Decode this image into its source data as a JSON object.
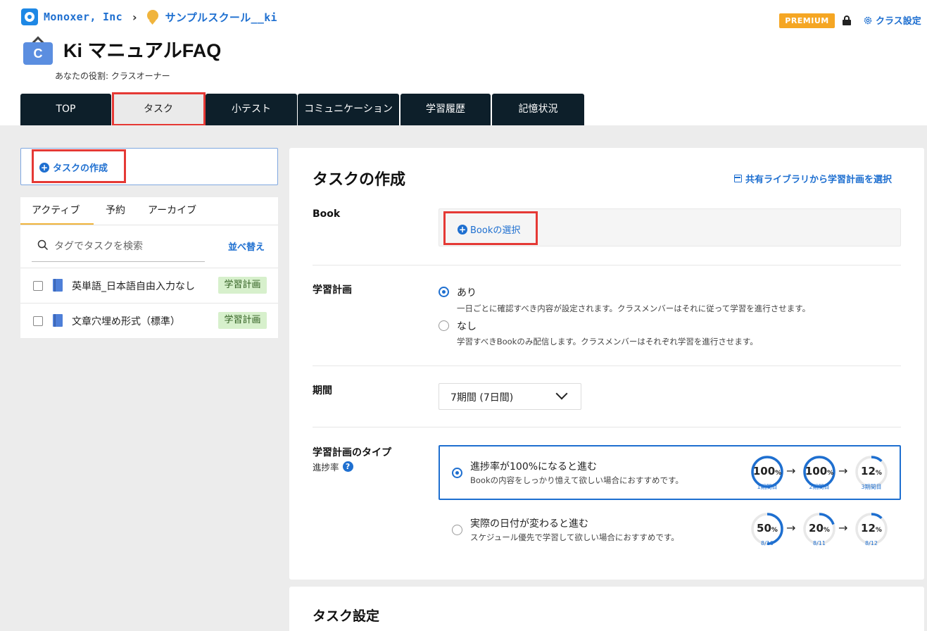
{
  "breadcrumb": {
    "org": "Monoxer, Inc",
    "school": "サンプルスクール__ki"
  },
  "header": {
    "class_title": "Ki マニュアルFAQ",
    "class_icon_letter": "C",
    "role": "あなたの役割: クラスオーナー",
    "premium_badge": "PREMIUM",
    "class_settings": "クラス設定"
  },
  "tabs": [
    "TOP",
    "タスク",
    "小テスト",
    "コミュニケーション",
    "学習履歴",
    "記憶状況"
  ],
  "sidebar": {
    "create_task": "タスクの作成",
    "list_tabs": [
      "アクティブ",
      "予約",
      "アーカイブ"
    ],
    "search_placeholder": "タグでタスクを検索",
    "sort": "並べ替え",
    "tasks": [
      {
        "name": "英単語_日本語自由入力なし",
        "tag": "学習計画"
      },
      {
        "name": "文章穴埋め形式（標準）",
        "tag": "学習計画"
      }
    ]
  },
  "form": {
    "title": "タスクの作成",
    "library_link": "共有ライブラリから学習計画を選択",
    "book_label": "Book",
    "book_button": "Bookの選択",
    "plan_label": "学習計画",
    "plan_options": [
      {
        "title": "あり",
        "desc": "一日ごとに確認すべき内容が設定されます。クラスメンバーはそれに従って学習を進行させます。",
        "selected": true
      },
      {
        "title": "なし",
        "desc": "学習すべきBookのみ配信します。クラスメンバーはそれぞれ学習を進行させます。",
        "selected": false
      }
    ],
    "period_label": "期間",
    "period_value": "7期間 (7日間)",
    "type_label": "学習計画のタイプ",
    "type_sublabel": "進捗率",
    "help_icon": "?",
    "type_options": [
      {
        "title": "進捗率が100%になると進む",
        "desc": "Bookの内容をしっかり憶えて欲しい場合におすすめです。",
        "selected": true,
        "rings": [
          {
            "value": "100",
            "unit": "%",
            "caption": "1期間目",
            "progress": 1.0
          },
          {
            "value": "100",
            "unit": "%",
            "caption": "2期間目",
            "progress": 1.0
          },
          {
            "value": "12",
            "unit": "%",
            "caption": "3期間目",
            "progress": 0.12
          }
        ]
      },
      {
        "title": "実際の日付が変わると進む",
        "desc": "スケジュール優先で学習して欲しい場合におすすめです。",
        "selected": false,
        "rings": [
          {
            "value": "50",
            "unit": "%",
            "caption": "8/10",
            "progress": 0.5
          },
          {
            "value": "20",
            "unit": "%",
            "caption": "8/11",
            "progress": 0.2
          },
          {
            "value": "12",
            "unit": "%",
            "caption": "8/12",
            "progress": 0.12
          }
        ]
      }
    ],
    "arrow": "→"
  },
  "settings": {
    "title": "タスク設定"
  },
  "colors": {
    "accent": "#1e6fd0",
    "highlight": "#e53935",
    "tab_bg": "#0d1f2a",
    "premium": "#f5a623",
    "tag_bg": "#d7f0cc"
  }
}
